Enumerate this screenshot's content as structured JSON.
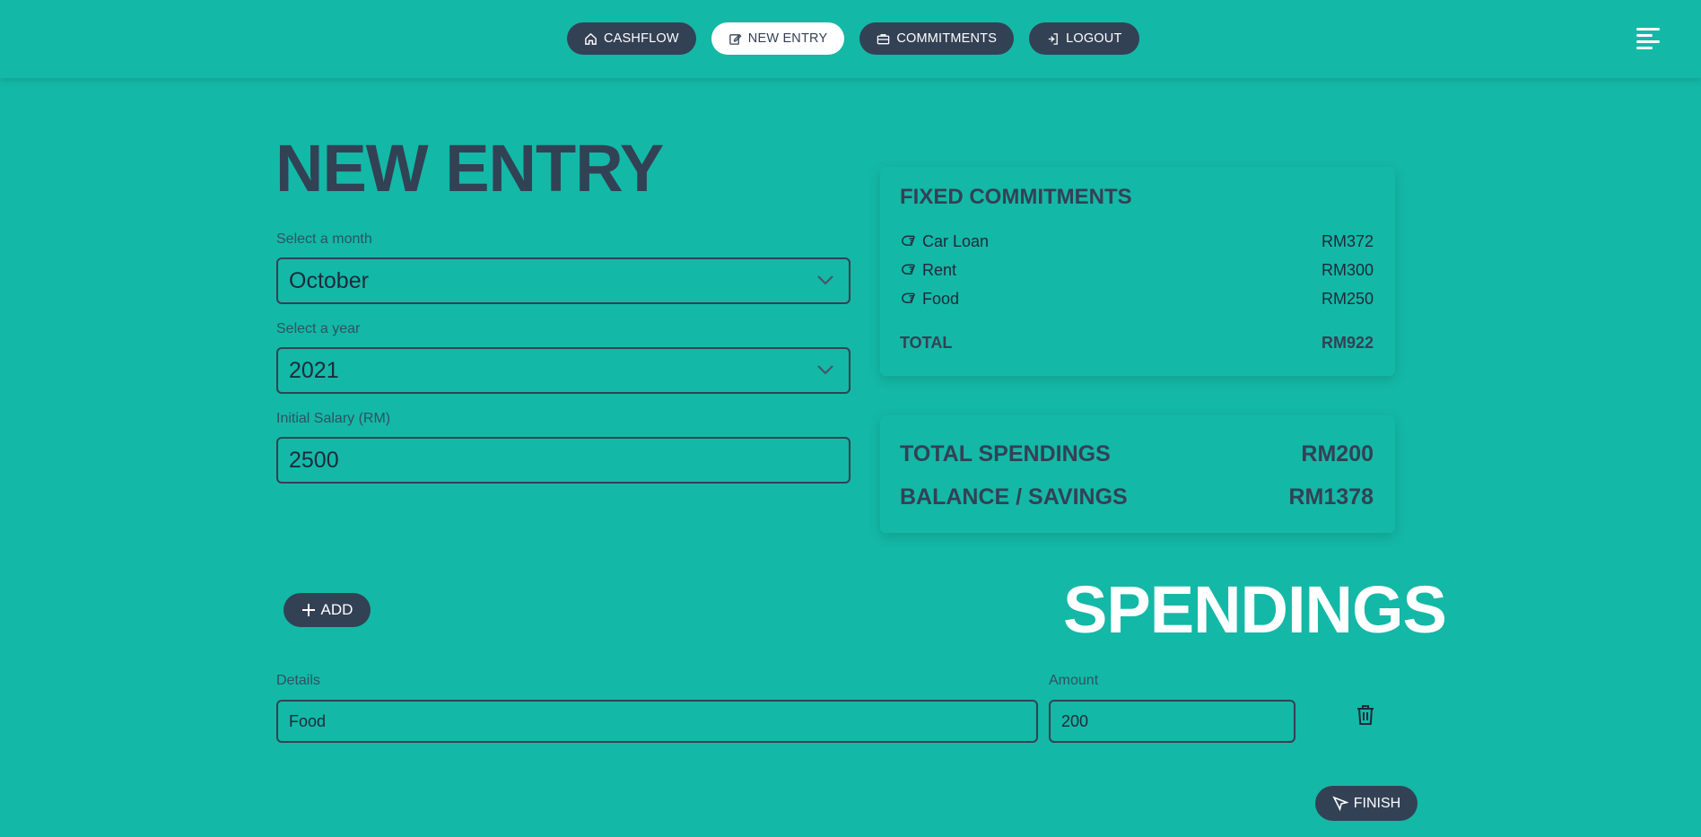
{
  "nav": {
    "items": [
      {
        "label": "CASHFLOW",
        "icon": "home-icon"
      },
      {
        "label": "NEW ENTRY",
        "icon": "edit-icon",
        "active": true
      },
      {
        "label": "COMMITMENTS",
        "icon": "briefcase-icon"
      },
      {
        "label": "LOGOUT",
        "icon": "logout-icon"
      }
    ],
    "menu_icon": "hamburger-icon"
  },
  "form": {
    "title": "NEW ENTRY",
    "month_label": "Select a month",
    "month_value": "October",
    "year_label": "Select a year",
    "year_value": "2021",
    "salary_label": "Initial Salary (RM)",
    "salary_value": "2500"
  },
  "commitments": {
    "title": "FIXED COMMITMENTS",
    "items": [
      {
        "name": "Car Loan",
        "amount": "RM372"
      },
      {
        "name": "Rent",
        "amount": "RM300"
      },
      {
        "name": "Food",
        "amount": "RM250"
      }
    ],
    "total_label": "TOTAL",
    "total_value": "RM922"
  },
  "summary": {
    "spendings_label": "TOTAL SPENDINGS",
    "spendings_value": "RM200",
    "balance_label": "BALANCE / SAVINGS",
    "balance_value": "RM1378"
  },
  "spendings": {
    "title": "SPENDINGS",
    "add_label": "ADD",
    "details_label": "Details",
    "amount_label": "Amount",
    "rows": [
      {
        "details": "Food",
        "amount": "200"
      }
    ],
    "finish_label": "FINISH"
  },
  "colors": {
    "background": "#14b8a6",
    "dark": "#334155",
    "white": "#ffffff"
  }
}
